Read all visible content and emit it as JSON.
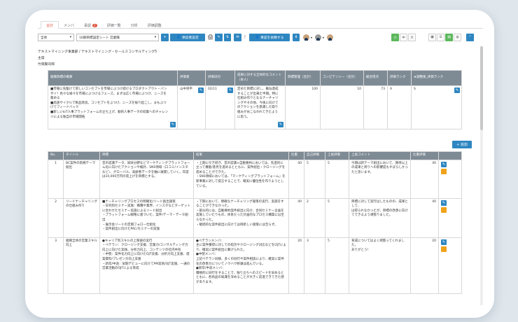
{
  "tabs": [
    {
      "label": "合計",
      "active": true
    },
    {
      "label": "メンバ"
    },
    {
      "label": "承認",
      "badge": "2"
    },
    {
      "label": "評価一覧"
    },
    {
      "label": "分析"
    },
    {
      "label": "評価調整"
    }
  ],
  "toolbar": {
    "scope_select": "全体",
    "sheet_select": "16期目標設定シート 営業職",
    "approver_button": "承認者設定",
    "approval_request_button": "承認を依頼する",
    "size_small": "小",
    "size_medium": "中",
    "size_large": "大"
  },
  "info": {
    "company": "テキストマイニング事業部 / テキストマイニング・セールスコンサルティング5",
    "position": "主席",
    "name": "竹岡賢司郎"
  },
  "summary_table": {
    "headers": [
      "組織目標の概要",
      "評価者",
      "評価日付",
      "成果に対する全体的なコメント（本人）",
      "目標管理（合計）",
      "コンピテンシー（合計）",
      "総合得点",
      "評価ランク",
      "★調整後_評価ランク"
    ],
    "row": {
      "overview": "■市場に先駆けて新しいコンセプトを市場にぶつけ続けるプロダクトアウト・バンザイ！色々な様々を市場にぶつけるフェーズ。まずは広く市場にぶつけ、ニーズを集める\n■高速サイクルで製品改良。コンセプトをぶつけ、ニーズを振り起こし、まもぶつけてフィードバック\n■新しいIoT人事プラットフォームの立ち上げ、動的人事データの収集へのチャレンジによる独自の市場開拓",
      "evaluator": "山中崇平",
      "date": "02/11",
      "comment": "定めた目標に対し、概ね達成することが出来た半期。特に仕組み作りとなるナーチャリングやその他、今後に向けてのアクションを意識した取り組みがおこなわれてきたように思う。",
      "mbo": "100",
      "competency": "10",
      "total": "73",
      "rank": "A",
      "adjusted_rank": "S"
    }
  },
  "add_button": "追加",
  "goal_table": {
    "headers": [
      "No.",
      "タイトル",
      "目標",
      "結果",
      "比重",
      "自己評価",
      "上長評価",
      "上長コメント",
      "比重評価"
    ],
    "rows": [
      {
        "no": "1",
        "title": "BC案件の新規テーマ創出",
        "goal": "音声認識データ、知財分野などマーケティングプラットフォーム化に向けたアクションや検討、SNS領域（口コミ/インスタなど）、グローバル、高齢者データを軸に展開していく。年度は10,000万円の売上げを目標とする。",
        "result": "・上期に引き続き、音声認識×自動要約においては、先進的に立って機能/意見を進めるとともに、案件創出・クロージングを進めることができた。\n・SNS領域においては、「マーケティングプラットフォーム」を新事業に対して提言することで、確実に優位性を作りようとしている。",
        "weight": "40",
        "self": "5",
        "boss": "5",
        "boss_comment": "今期は新テーマ創出において、期待以上の成果と周りへの影響度もすばらしかったと思います。",
        "weighted": "40"
      },
      {
        "no": "2",
        "title": "リードナーチャリングの仕組み作り",
        "goal": "■ナーチャリングプロセスの明確化/リード創出施策\n・日刊別セミナー実施：職種や業界、インスタなどターゲットに合わせたセミナー実施によるリード創出\n・プラットフォーム戦略に基づいた、案件/テーマ・データ創出\n・展示会リードの定期フォロー仕組化\n・案件創出に向けたPAC/セミナーの実施",
        "result": "・下期において、明確なナーチャリング施策の実行、実施をすることができなかった。\n・部分的には、自動要約案件創出に向け、合同セミナー企画を実施していたりもの、体系だった計画的なプロセス構築には至らなかった。\n・継続的な案件創出に向けては目新しい施策には至らず。",
        "weight": "40",
        "self": "2",
        "boss": "5",
        "boss_comment": "目標に対して実行はしたものの、成果として、\nは得られなかったが、目標の改善に向けてできるよう頑張りました。",
        "weighted": "40"
      },
      {
        "no": "3",
        "title": "組織全体の営業スキル向上",
        "goal": "●キャリア別スキルの上限値の実行\n・ベテラン：クロージング支援、営業力/コンサルティング力向上に向けた実践、分析力向上、コンテンツの社内共有\n・中堅：案件化力向上に向けたOJT支援、分析力向上支援、提案資料/プレゼン力向上支援\n・新卒/中途：早期デビューに向けてPM実地/OJT実施、一通の営業活動のOJTによる育成",
        "result": "●ベテランメンバ：\n主に案件獲得に対しての指示やクロージング対応などをOJTにより、確実に案件創出に繋げられた。\n●中堅メンバ：\n上記ベテラン同様、多くの同行や案件相談により、確実に案件化の改善力についてノウハウ移譲は進んでいる。\n●新卒/中途メンバ：\n積極的に同行をすることで、独り立ちへのスピードを早めるとともに、各商品の知識を深めることが大きく前進できてきた感があります。",
        "weight": "20",
        "self": "3",
        "boss": "5",
        "boss_comment": "育成についてはよく頑張ってくれました。\nありがとう！",
        "weighted": "20"
      }
    ]
  }
}
